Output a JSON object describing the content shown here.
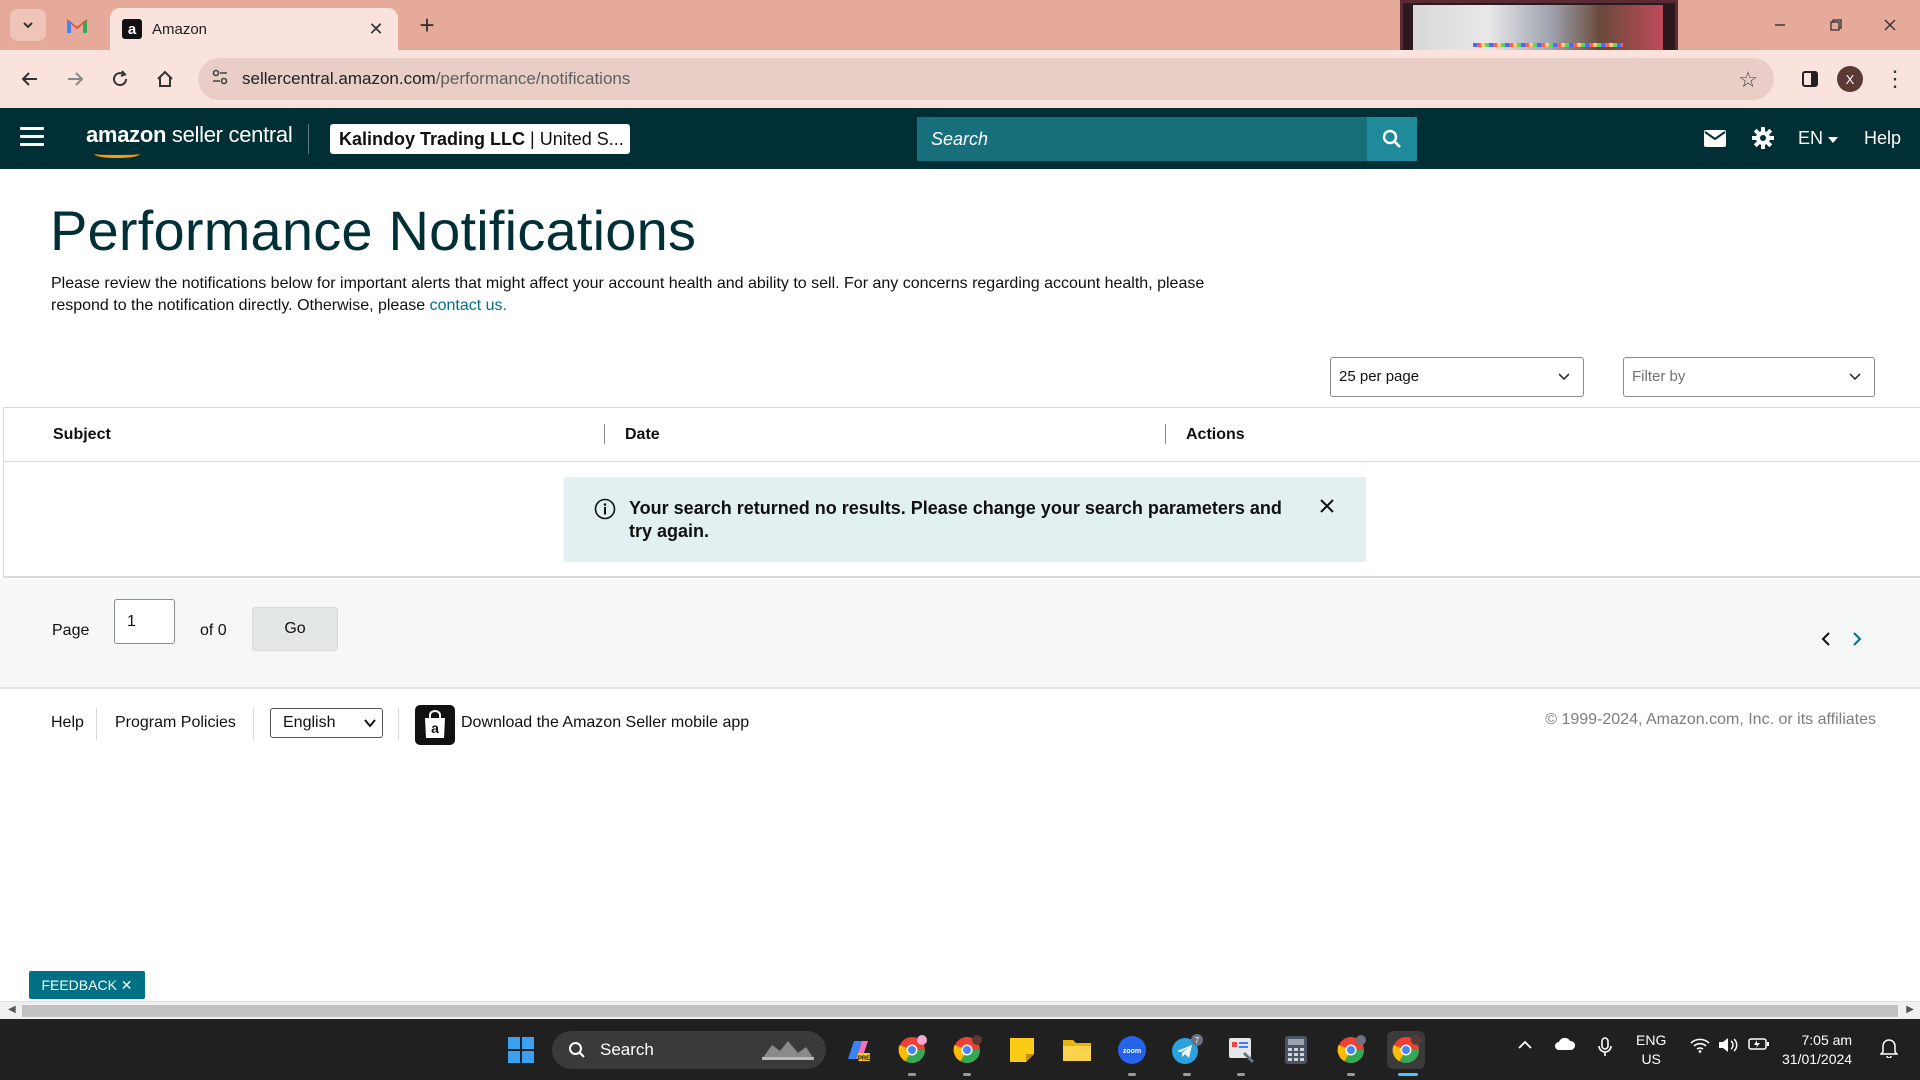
{
  "browser": {
    "tab_title": "Amazon",
    "url_host": "sellercentral.amazon.com",
    "url_path": "/performance/notifications",
    "profile_initial": "X"
  },
  "header": {
    "logo_bold": "amazon",
    "logo_rest": " seller central",
    "account_name": "Kalindoy Trading LLC",
    "account_marketplace": " | United S...",
    "search_placeholder": "Search",
    "language": "EN",
    "help": "Help"
  },
  "page": {
    "title": "Performance Notifications",
    "intro_text": "Please review the notifications below for important alerts that might affect your account health and ability to sell. For any concerns regarding account health, please respond to the notification directly. Otherwise, please ",
    "intro_link": "contact us."
  },
  "controls": {
    "per_page": "25 per page",
    "filter_placeholder": "Filter by"
  },
  "table": {
    "columns": [
      "Subject",
      "Date",
      "Actions"
    ],
    "empty_message": "Your search returned no results. Please change your search parameters and try again."
  },
  "pagination": {
    "page_label": "Page",
    "current_page": "1",
    "of_label": "of 0",
    "go_label": "Go"
  },
  "footer": {
    "help": "Help",
    "program_policies": "Program Policies",
    "language": "English",
    "app_text": "Download the Amazon Seller mobile app",
    "copyright": "© 1999-2024, Amazon.com, Inc. or its affiliates"
  },
  "feedback": {
    "label": "FEEDBACK ✕"
  },
  "taskbar": {
    "search_label": "Search",
    "lang_line1": "ENG",
    "lang_line2": "US",
    "time": "7:05 am",
    "date": "31/01/2024",
    "telegram_badge": "7"
  },
  "colors": {
    "header_bg": "#002f36",
    "search_bg": "#176f7c",
    "link": "#00708a",
    "alert_bg": "#e3f0f2",
    "feedback_bg": "#007185",
    "tabstrip_bg": "#e6aa9a"
  }
}
